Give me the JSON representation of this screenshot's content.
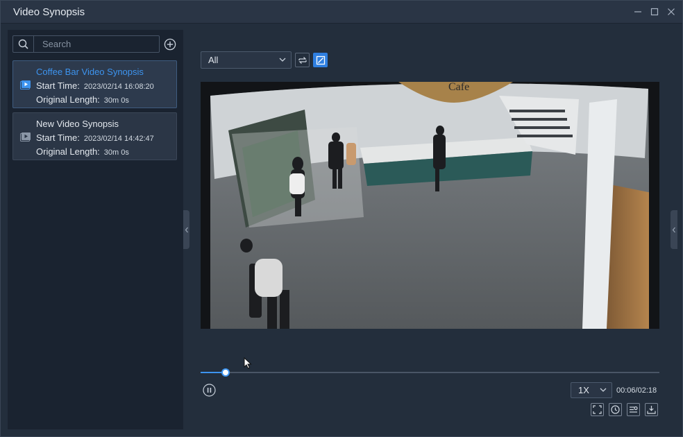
{
  "window": {
    "title": "Video Synopsis"
  },
  "search": {
    "placeholder": "Search"
  },
  "synopsis_list": [
    {
      "name": "Coffee Bar Video Synopsis",
      "start_label": "Start Time:",
      "start_value": "2023/02/14 16:08:20",
      "length_label": "Original Length:",
      "length_value": "30m 0s",
      "active": true
    },
    {
      "name": "New Video Synopsis",
      "start_label": "Start Time:",
      "start_value": "2023/02/14 14:42:47",
      "length_label": "Original Length:",
      "length_value": "30m 0s",
      "active": false
    }
  ],
  "toolbar": {
    "filter_value": "All"
  },
  "video": {
    "sign_text": "Cafe"
  },
  "playback": {
    "progress_fraction": 0.054,
    "speed": "1X",
    "time": "00:06/02:18"
  },
  "colors": {
    "accent": "#3d94ef",
    "background": "#232e3c",
    "panel": "#1a2330"
  },
  "icons": [
    "search-icon",
    "add-icon",
    "video-icon",
    "swap-icon",
    "crop-frame-icon",
    "chevron-down-icon",
    "pause-icon",
    "fullscreen-icon",
    "clock-icon",
    "filter-list-icon",
    "download-icon",
    "minimize-icon",
    "maximize-icon",
    "close-icon",
    "collapse-left-icon",
    "collapse-right-icon"
  ]
}
